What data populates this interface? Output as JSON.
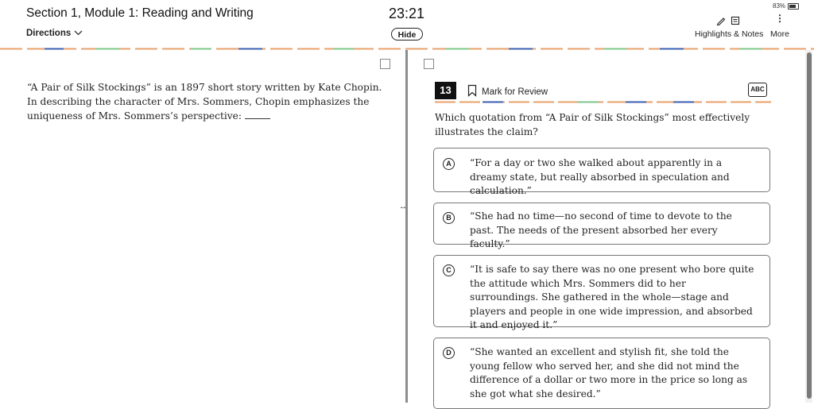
{
  "header": {
    "section_title": "Section 1, Module 1: Reading and Writing",
    "directions_label": "Directions",
    "timer": "23:21",
    "hide_label": "Hide",
    "battery": "83%",
    "highlights_label": "Highlights & Notes",
    "more_label": "More"
  },
  "passage": {
    "text": "“A Pair of Silk Stockings” is an 1897 short story written by Kate Chopin. In describing the character of Mrs. Sommers, Chopin emphasizes the uniqueness of Mrs. Sommers’s perspective: "
  },
  "question": {
    "number": "13",
    "mark_label": "Mark for Review",
    "abc_label": "ABC",
    "stem": "Which quotation from “A Pair of Silk Stockings” most effectively illustrates the claim?",
    "choices": [
      {
        "letter": "A",
        "text": "“For a day or two she walked about apparently in a dreamy state, but really absorbed in speculation and calculation.”"
      },
      {
        "letter": "B",
        "text": "“She had no time—no second of time to devote to the past. The needs of the present absorbed her every faculty.”"
      },
      {
        "letter": "C",
        "text": "“It is safe to say there was no one present who bore quite the attitude which Mrs. Sommers did to her surroundings. She gathered in the whole—stage and players and people in one wide impression, and absorbed it and enjoyed it.”"
      },
      {
        "letter": "D",
        "text": "“She wanted an excellent and stylish fit, she told the young fellow who served her, and she did not mind the difference of a dollar or two more in the price so long as she got what she desired.”"
      }
    ]
  },
  "colors": {
    "dash_palette": [
      "#e8a06a",
      "#3a5fb0",
      "#7cc68a",
      "#e8a06a"
    ]
  }
}
